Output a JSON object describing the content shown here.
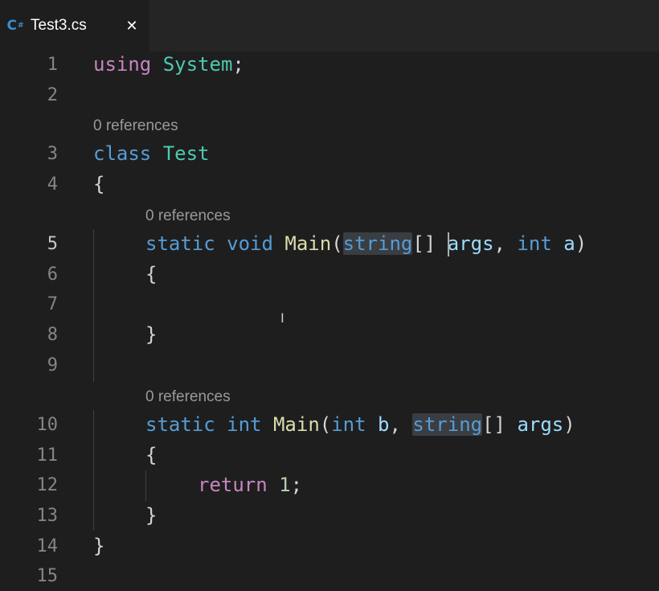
{
  "tab": {
    "icon_label": "C",
    "icon_sup": "#",
    "title": "Test3.cs",
    "close_glyph": "✕"
  },
  "codelens": [
    "0 references",
    "0 references",
    "0 references"
  ],
  "line_numbers": [
    "1",
    "2",
    "3",
    "4",
    "5",
    "6",
    "7",
    "8",
    "9",
    "10",
    "11",
    "12",
    "13",
    "14",
    "15"
  ],
  "code": {
    "line1": {
      "kw": "using",
      "ty": "System",
      "punct": ";"
    },
    "line3": {
      "kw": "class",
      "ty": "Test"
    },
    "line4": "{",
    "line5": {
      "static": "static",
      "void": "void",
      "fn": "Main",
      "open": "(",
      "string": "string",
      "brackets": "[]",
      "args": "args",
      "comma": ",",
      "int": "int",
      "a": "a",
      "close": ")"
    },
    "line6": "{",
    "line8": "}",
    "line10": {
      "static": "static",
      "int": "int",
      "fn": "Main",
      "open": "(",
      "int2": "int",
      "b": "b",
      "comma": ",",
      "string": "string",
      "brackets": "[]",
      "args": "args",
      "close": ")"
    },
    "line11": "{",
    "line12": {
      "ret": "return",
      "num": "1",
      "punct": ";"
    },
    "line13": "}",
    "line14": "}"
  },
  "colors": {
    "keyword": "#569cd6",
    "control_keyword": "#c586c0",
    "type": "#4ec9b0",
    "function": "#dcdcaa",
    "parameter": "#9cdcfe",
    "number": "#b5cea8",
    "background": "#1e1e1e"
  },
  "icons": {
    "tab_icon": "csharp-file-icon",
    "close": "close-icon",
    "mouse": "text-cursor-icon"
  },
  "mouse_cursor": "I"
}
